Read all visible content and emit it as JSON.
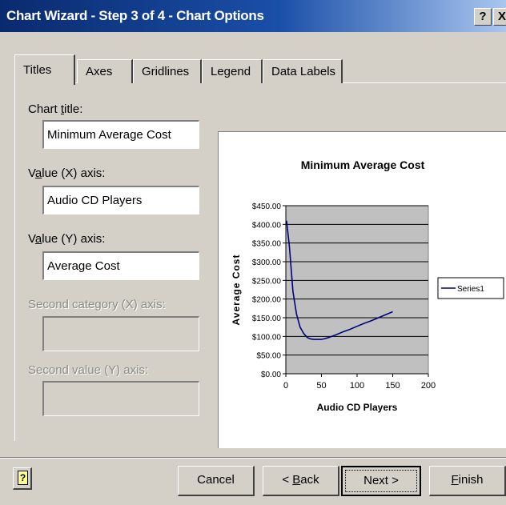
{
  "window": {
    "title": "Chart Wizard - Step 3 of 4 - Chart Options",
    "help_glyph": "?",
    "close_glyph": "X"
  },
  "tabs": [
    {
      "label": "Titles",
      "active": true
    },
    {
      "label": "Axes",
      "active": false
    },
    {
      "label": "Gridlines",
      "active": false
    },
    {
      "label": "Legend",
      "active": false
    },
    {
      "label": "Data Labels",
      "active": false
    }
  ],
  "fields": {
    "chart_title": {
      "label": "Chart title:",
      "value": "Minimum Average Cost"
    },
    "x_axis": {
      "label": "Value (X) axis:",
      "value": "Audio CD Players"
    },
    "y_axis": {
      "label": "Value (Y) axis:",
      "value": "Average Cost"
    },
    "second_x": {
      "label": "Second category (X) axis:",
      "value": ""
    },
    "second_y": {
      "label": "Second value (Y) axis:",
      "value": ""
    }
  },
  "buttons": {
    "cancel": "Cancel",
    "back": "< Back",
    "next": "Next >",
    "finish": "Finish"
  },
  "icons": {
    "help": "help-icon",
    "close": "close-icon"
  },
  "colors": {
    "title_bar": "#1a4fa8",
    "plot_area": "#c0c0c0",
    "series_line": "#000080"
  },
  "chart_data": {
    "type": "line",
    "title": "Minimum Average Cost",
    "xlabel": "Audio CD Players",
    "ylabel": "Average Cost",
    "xlim": [
      0,
      200
    ],
    "ylim": [
      0,
      450
    ],
    "x_ticks": [
      "0",
      "50",
      "100",
      "150",
      "200"
    ],
    "y_ticks": [
      "$0.00",
      "$50.00",
      "$100.00",
      "$150.00",
      "$200.00",
      "$250.00",
      "$300.00",
      "$350.00",
      "$400.00",
      "$450.00"
    ],
    "grid": true,
    "legend": "right",
    "series": [
      {
        "name": "Series1",
        "x": [
          1,
          5,
          10,
          15,
          20,
          25,
          30,
          35,
          40,
          45,
          50,
          55,
          60,
          70,
          80,
          90,
          100,
          110,
          120,
          130,
          140,
          150
        ],
        "y": [
          410,
          340,
          220,
          160,
          125,
          108,
          97,
          93,
          92,
          92,
          92,
          94,
          97,
          104,
          112,
          119,
          127,
          135,
          142,
          150,
          158,
          166
        ]
      }
    ]
  }
}
